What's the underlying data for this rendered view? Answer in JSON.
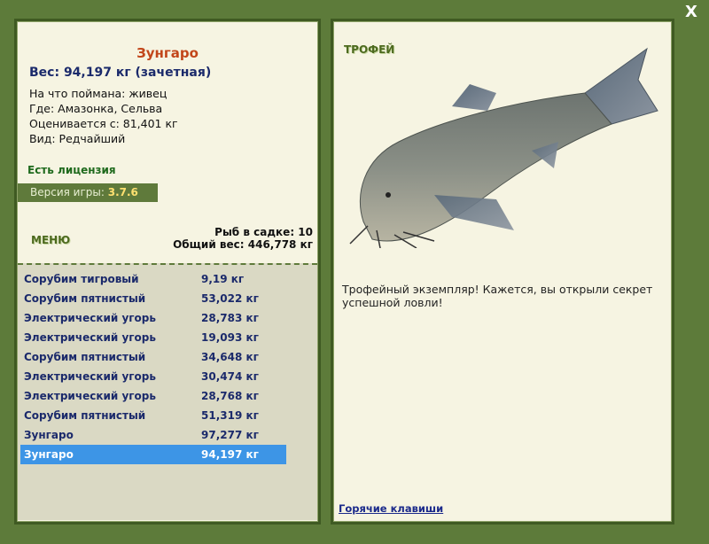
{
  "close_label": "X",
  "fish": {
    "name": "Зунгаро",
    "weight_line": "Вес: 94,197 кг (зачетная)",
    "bait_line": "На что поймана: живец",
    "place_line": "Где: Амазонка, Сельва",
    "valued_line": "Оценивается с: 81,401 кг",
    "kind_line": "Вид: Редчайший"
  },
  "license": "Есть лицензия",
  "version": {
    "label": "Версия игры:",
    "value": "3.7.6"
  },
  "menu_label": "МЕНЮ",
  "cage": {
    "count_line": "Рыб в садке: 10",
    "total_line": "Общий вес: 446,778 кг"
  },
  "catches": [
    {
      "name": "Сорубим тигровый",
      "weight": "9,19 кг"
    },
    {
      "name": "Сорубим пятнистый",
      "weight": "53,022 кг"
    },
    {
      "name": "Электрический угорь",
      "weight": "28,783 кг"
    },
    {
      "name": "Электрический угорь",
      "weight": "19,093 кг"
    },
    {
      "name": "Сорубим пятнистый",
      "weight": "34,648 кг"
    },
    {
      "name": "Электрический угорь",
      "weight": "30,474 кг"
    },
    {
      "name": "Электрический угорь",
      "weight": "28,768 кг"
    },
    {
      "name": "Сорубим пятнистый",
      "weight": "51,319 кг"
    },
    {
      "name": "Зунгаро",
      "weight": "97,277 кг"
    },
    {
      "name": "Зунгаро",
      "weight": "94,197 кг",
      "selected": true
    }
  ],
  "trophy_label": "ТРОФЕЙ",
  "description": "Трофейный экземпляр! Кажется, вы открыли секрет успешной ловли!",
  "hotkeys": "Горячие клавиши",
  "colors": {
    "background": "#5d7b3a",
    "panel": "#f6f4e2",
    "selected_row": "#3d95e6",
    "fish_name": "#c2461a"
  }
}
